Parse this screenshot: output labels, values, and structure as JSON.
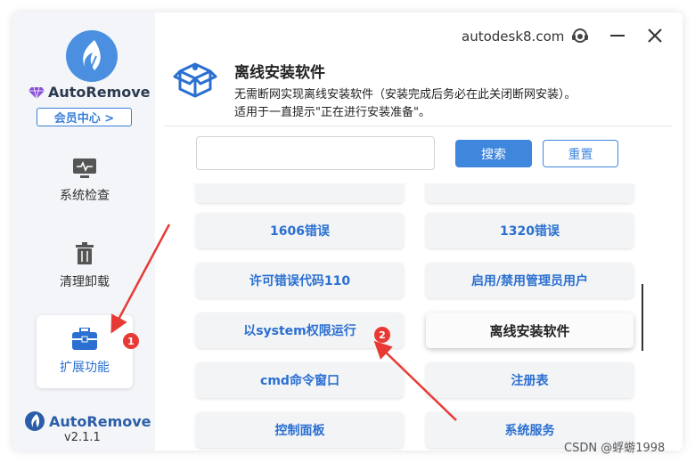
{
  "sidebar": {
    "brand": "AutoRemove",
    "member_center": "会员中心 >",
    "nav": [
      {
        "label": "系统检查",
        "icon": "monitor-icon"
      },
      {
        "label": "清理卸载",
        "icon": "trash-icon"
      },
      {
        "label": "扩展功能",
        "icon": "toolbox-icon",
        "active": true
      }
    ],
    "footer_brand": "AutoRemove",
    "version": "v2.1.1"
  },
  "header": {
    "website": "autodesk8.com",
    "title": "离线安装软件",
    "desc_line1": "无需断网实现离线安装软件（安装完成后务必在此关闭断网安装）。",
    "desc_line2": "适用于一直提示\"正在进行安装准备\"。"
  },
  "search": {
    "placeholder": "",
    "search_label": "搜索",
    "reset_label": "重置"
  },
  "tools": [
    [
      "",
      ""
    ],
    [
      "1606错误",
      "1320错误"
    ],
    [
      "许可错误代码110",
      "启用/禁用管理员用户"
    ],
    [
      "以system权限运行",
      "离线安装软件"
    ],
    [
      "cmd命令窗口",
      "注册表"
    ],
    [
      "控制面板",
      "系统服务"
    ]
  ],
  "callouts": [
    "1",
    "2"
  ],
  "watermark": "CSDN @蜉蝣1998",
  "colors": {
    "accent": "#3f86dd",
    "tile_text": "#2a6fd1",
    "callout": "#e83a35"
  }
}
